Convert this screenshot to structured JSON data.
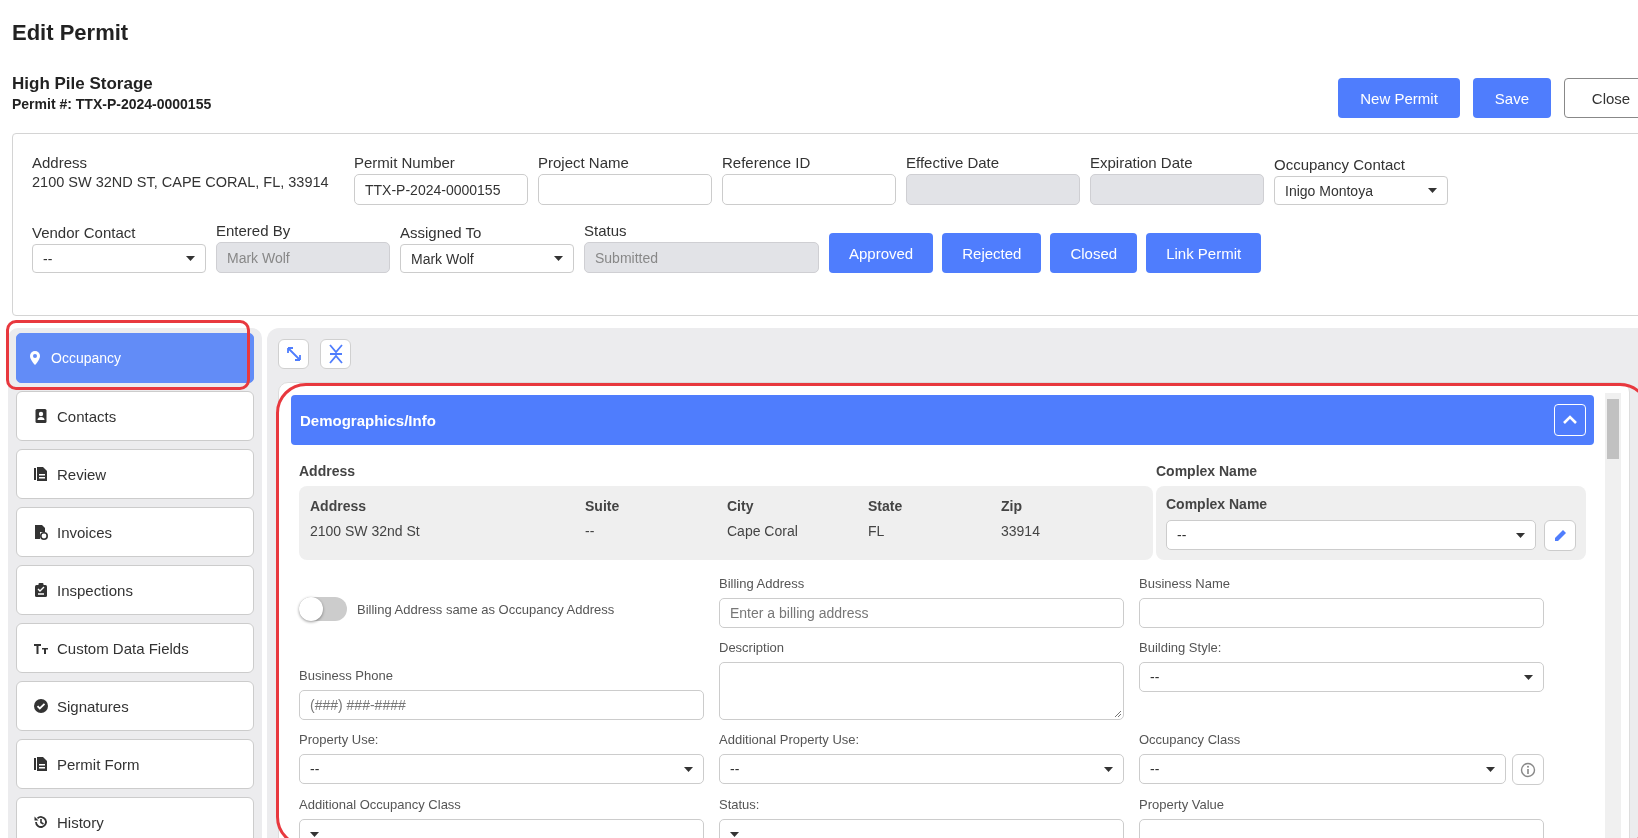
{
  "page_title": "Edit Permit",
  "permit": {
    "type": "High Pile Storage",
    "number": "Permit #: TTX-P-2024-0000155"
  },
  "actions": [
    {
      "label": "New Permit",
      "kind": "primary"
    },
    {
      "label": "Save",
      "kind": "primary"
    },
    {
      "label": "Close",
      "kind": "secondary"
    }
  ],
  "header_rows": [
    [
      {
        "label": "Address",
        "kind": "text",
        "value": "2100 SW 32ND ST, CAPE CORAL, FL, 33914"
      },
      {
        "label": "Permit Number",
        "kind": "input",
        "value": "TTX-P-2024-0000155",
        "disabled": false
      },
      {
        "label": "Project Name",
        "kind": "input",
        "disabled": false
      },
      {
        "label": "Reference ID",
        "kind": "input",
        "disabled": false
      },
      {
        "label": "Effective Date",
        "kind": "input",
        "disabled": true
      },
      {
        "label": "Expiration Date",
        "kind": "input",
        "disabled": true
      },
      {
        "label": "Occupancy Contact",
        "kind": "select",
        "value": "Inigo Montoya"
      }
    ],
    [
      {
        "label": "Vendor Contact",
        "kind": "select",
        "value": "--"
      },
      {
        "label": "Entered By",
        "kind": "input",
        "value": "Mark Wolf",
        "disabled": true
      },
      {
        "label": "Assigned To",
        "kind": "select",
        "value": "Mark Wolf"
      },
      {
        "label": "Status",
        "kind": "input",
        "value": "Submitted",
        "disabled": true
      }
    ]
  ],
  "status_buttons": [
    "Approved",
    "Rejected",
    "Closed",
    "Link Permit"
  ],
  "toolbar": [
    {
      "kind": "expand"
    },
    {
      "kind": "collapse"
    }
  ],
  "sidebar": [
    {
      "label": "Occupancy",
      "selected": true
    },
    {
      "label": "Contacts",
      "selected": false
    },
    {
      "label": "Review",
      "selected": false
    },
    {
      "label": "Invoices",
      "selected": false
    },
    {
      "label": "Inspections",
      "selected": false
    },
    {
      "label": "Custom Data Fields",
      "selected": false
    },
    {
      "label": "Signatures",
      "selected": false
    },
    {
      "label": "Permit Form",
      "selected": false
    },
    {
      "label": "History",
      "selected": false
    }
  ],
  "section": {
    "title": "Demographics/Info",
    "expanded": true,
    "address": {
      "heading": "Address",
      "columns": [
        "Address",
        "Suite",
        "City",
        "State",
        "Zip"
      ],
      "values": [
        "2100 SW 32nd St",
        "--",
        "Cape Coral",
        "FL",
        "33914"
      ]
    },
    "complex": {
      "heading": "Complex Name",
      "label": "Complex Name",
      "value": "--"
    },
    "fields": [
      {
        "kind": "toggle",
        "label": "Billing Address same as Occupancy Address",
        "on": false
      },
      {
        "kind": "input",
        "label": "Billing Address",
        "placeholder": "Enter a billing address"
      },
      {
        "kind": "input",
        "label": "Business Name"
      },
      {
        "kind": "input",
        "label": "Business Phone",
        "placeholder": "(###) ###-####"
      },
      {
        "kind": "textarea",
        "label": "Description"
      },
      {
        "kind": "select",
        "label": "Building Style:",
        "value": "--"
      },
      {
        "kind": "select",
        "label": "Property Use:",
        "value": "--"
      },
      {
        "kind": "select",
        "label": "Additional Property Use:",
        "value": "--"
      },
      {
        "kind": "select",
        "label": "Occupancy Class",
        "value": "--",
        "info": true
      },
      {
        "kind": "select",
        "label": "Additional Occupancy Class"
      },
      {
        "kind": "select",
        "label": "Status:"
      },
      {
        "kind": "input",
        "label": "Property Value"
      }
    ]
  }
}
